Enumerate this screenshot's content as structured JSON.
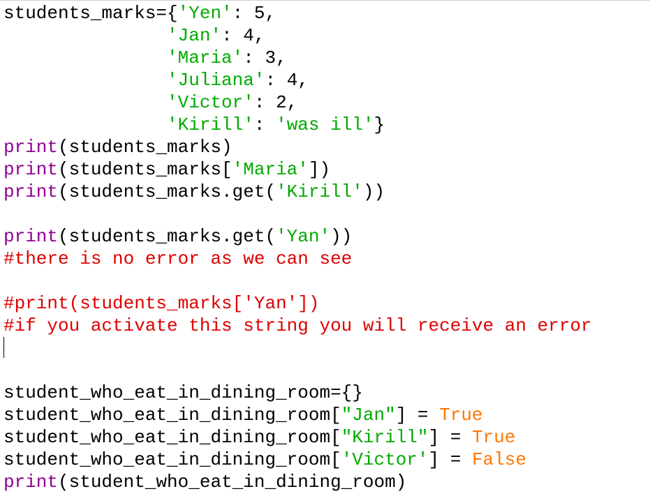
{
  "editor": {
    "colors": {
      "default": "#000000",
      "builtin": "#900090",
      "string": "#00aa00",
      "comment": "#dd0000",
      "keyword": "#ff7700"
    },
    "lines": [
      [
        {
          "t": "students_marks={",
          "c": "default"
        },
        {
          "t": "'Yen'",
          "c": "string"
        },
        {
          "t": ": 5,",
          "c": "default"
        }
      ],
      [
        {
          "t": "               ",
          "c": "default"
        },
        {
          "t": "'Jan'",
          "c": "string"
        },
        {
          "t": ": 4,",
          "c": "default"
        }
      ],
      [
        {
          "t": "               ",
          "c": "default"
        },
        {
          "t": "'Maria'",
          "c": "string"
        },
        {
          "t": ": 3,",
          "c": "default"
        }
      ],
      [
        {
          "t": "               ",
          "c": "default"
        },
        {
          "t": "'Juliana'",
          "c": "string"
        },
        {
          "t": ": 4,",
          "c": "default"
        }
      ],
      [
        {
          "t": "               ",
          "c": "default"
        },
        {
          "t": "'Victor'",
          "c": "string"
        },
        {
          "t": ": 2,",
          "c": "default"
        }
      ],
      [
        {
          "t": "               ",
          "c": "default"
        },
        {
          "t": "'Kirill'",
          "c": "string"
        },
        {
          "t": ": ",
          "c": "default"
        },
        {
          "t": "'was ill'",
          "c": "string"
        },
        {
          "t": "}",
          "c": "default"
        }
      ],
      [
        {
          "t": "print",
          "c": "builtin"
        },
        {
          "t": "(students_marks)",
          "c": "default"
        }
      ],
      [
        {
          "t": "print",
          "c": "builtin"
        },
        {
          "t": "(students_marks[",
          "c": "default"
        },
        {
          "t": "'Maria'",
          "c": "string"
        },
        {
          "t": "])",
          "c": "default"
        }
      ],
      [
        {
          "t": "print",
          "c": "builtin"
        },
        {
          "t": "(students_marks.get(",
          "c": "default"
        },
        {
          "t": "'Kirill'",
          "c": "string"
        },
        {
          "t": "))",
          "c": "default"
        }
      ],
      [],
      [
        {
          "t": "print",
          "c": "builtin"
        },
        {
          "t": "(students_marks.get(",
          "c": "default"
        },
        {
          "t": "'Yan'",
          "c": "string"
        },
        {
          "t": "))",
          "c": "default"
        }
      ],
      [
        {
          "t": "#there is no error as we can see",
          "c": "comment"
        }
      ],
      [],
      [
        {
          "t": "#print(students_marks['Yan'])",
          "c": "comment"
        }
      ],
      [
        {
          "t": "#if you activate this string you will receive an error",
          "c": "comment"
        }
      ],
      [],
      [],
      [
        {
          "t": "student_who_eat_in_dining_room={}",
          "c": "default"
        }
      ],
      [
        {
          "t": "student_who_eat_in_dining_room[",
          "c": "default"
        },
        {
          "t": "\"Jan\"",
          "c": "string"
        },
        {
          "t": "] = ",
          "c": "default"
        },
        {
          "t": "True",
          "c": "keyword"
        }
      ],
      [
        {
          "t": "student_who_eat_in_dining_room[",
          "c": "default"
        },
        {
          "t": "\"Kirill\"",
          "c": "string"
        },
        {
          "t": "] = ",
          "c": "default"
        },
        {
          "t": "True",
          "c": "keyword"
        }
      ],
      [
        {
          "t": "student_who_eat_in_dining_room[",
          "c": "default"
        },
        {
          "t": "'Victor'",
          "c": "string"
        },
        {
          "t": "] = ",
          "c": "default"
        },
        {
          "t": "False",
          "c": "keyword"
        }
      ],
      [
        {
          "t": "print",
          "c": "builtin"
        },
        {
          "t": "(student_who_eat_in_dining_room)",
          "c": "default"
        }
      ]
    ]
  }
}
